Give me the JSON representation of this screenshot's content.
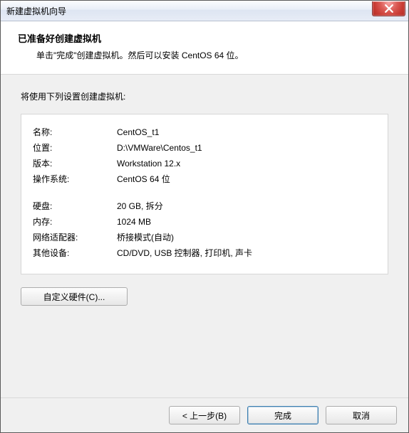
{
  "window": {
    "title": "新建虚拟机向导"
  },
  "header": {
    "heading": "已准备好创建虚拟机",
    "sub": "单击\"完成\"创建虚拟机。然后可以安装 CentOS 64 位。"
  },
  "lead": "将使用下列设置创建虚拟机:",
  "summary": {
    "name_label": "名称:",
    "name_value": "CentOS_t1",
    "location_label": "位置:",
    "location_value": "D:\\VMWare\\Centos_t1",
    "version_label": "版本:",
    "version_value": "Workstation 12.x",
    "os_label": "操作系统:",
    "os_value": "CentOS 64 位",
    "disk_label": "硬盘:",
    "disk_value": "20 GB, 拆分",
    "memory_label": "内存:",
    "memory_value": "1024 MB",
    "network_label": "网络适配器:",
    "network_value": "桥接模式(自动)",
    "other_label": "其他设备:",
    "other_value": "CD/DVD, USB 控制器, 打印机, 声卡"
  },
  "buttons": {
    "customize": "自定义硬件(C)...",
    "back": "< 上一步(B)",
    "finish": "完成",
    "cancel": "取消"
  }
}
